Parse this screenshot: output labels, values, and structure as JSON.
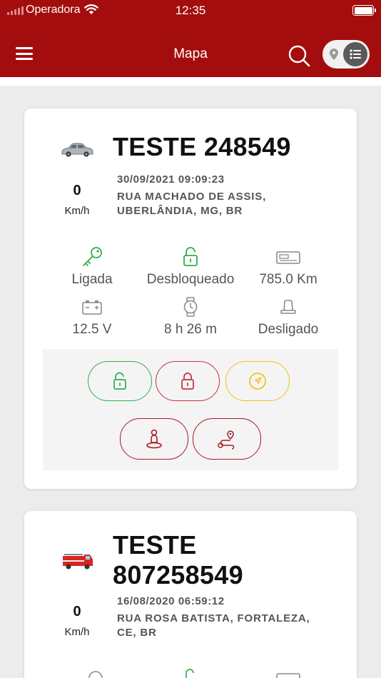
{
  "status_bar": {
    "carrier": "Operadora",
    "time": "12:35"
  },
  "header": {
    "title": "Mapa"
  },
  "colors": {
    "header_bg": "#a40d0d",
    "green": "#2bb14b",
    "red": "#c62f3a",
    "yellow": "#efc21b",
    "dark_red": "#a51b23"
  },
  "vehicles": [
    {
      "icon": "car-icon",
      "name": "TESTE 248549",
      "speed": "0",
      "speed_unit": "Km/h",
      "datetime": "30/09/2021 09:09:23",
      "address_line1": "RUA MACHADO DE ASSIS,",
      "address_line2": "UBERLÂNDIA, MG, BR",
      "stats": [
        {
          "icon": "key-icon",
          "label": "Ligada"
        },
        {
          "icon": "unlock-icon",
          "label": "Desbloqueado"
        },
        {
          "icon": "odometer-icon",
          "label": "785.0 Km"
        },
        {
          "icon": "battery-icon",
          "label": "12.5 V"
        },
        {
          "icon": "watch-icon",
          "label": "8 h 26 m"
        },
        {
          "icon": "siren-icon",
          "label": "Desligado"
        }
      ],
      "actions": [
        {
          "icon": "unlock-icon",
          "name": "unlock-button"
        },
        {
          "icon": "lock-icon",
          "name": "lock-button"
        },
        {
          "icon": "navigation-icon",
          "name": "navigate-button"
        },
        {
          "icon": "person-location-icon",
          "name": "person-location-button"
        },
        {
          "icon": "route-icon",
          "name": "route-button"
        }
      ]
    },
    {
      "icon": "fire-truck-icon",
      "name_line1": "TESTE",
      "name_line2": "807258549",
      "speed": "0",
      "speed_unit": "Km/h",
      "datetime": "16/08/2020 06:59:12",
      "address_line1": "RUA ROSA BATISTA, FORTALEZA,",
      "address_line2": "CE, BR"
    }
  ]
}
